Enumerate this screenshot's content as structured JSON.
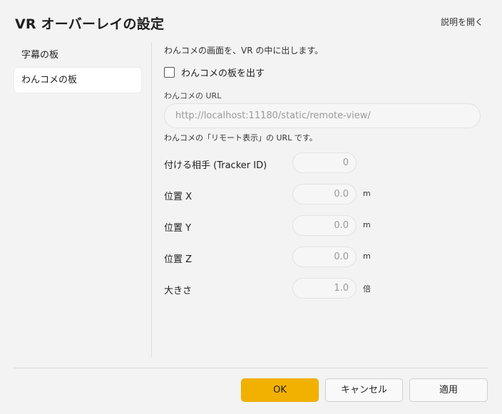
{
  "dialog": {
    "title": "VR オーバーレイの設定",
    "help_link": "説明を開く"
  },
  "sidebar": {
    "items": [
      {
        "label": "字幕の板",
        "selected": false
      },
      {
        "label": "わんコメの板",
        "selected": true
      }
    ]
  },
  "main": {
    "description": "わんコメの画面を、VR の中に出します。",
    "show_board_checkbox": {
      "label": "わんコメの板を出す",
      "checked": false
    },
    "url_field": {
      "label": "わんコメの URL",
      "value": "http://localhost:11180/static/remote-view/",
      "note": "わんコメの「リモート表示」の URL です。"
    },
    "tracker": {
      "label": "付ける相手 (Tracker ID)",
      "value": "0"
    },
    "position_x": {
      "label": "位置 X",
      "value": "0.0",
      "unit": "m"
    },
    "position_y": {
      "label": "位置 Y",
      "value": "0.0",
      "unit": "m"
    },
    "position_z": {
      "label": "位置 Z",
      "value": "0.0",
      "unit": "m"
    },
    "size": {
      "label": "大きさ",
      "value": "1.0",
      "unit": "倍"
    }
  },
  "footer": {
    "ok_label": "OK",
    "cancel_label": "キャンセル",
    "apply_label": "適用"
  },
  "colors": {
    "accent": "#f2b100",
    "background": "#f3f3f3"
  }
}
